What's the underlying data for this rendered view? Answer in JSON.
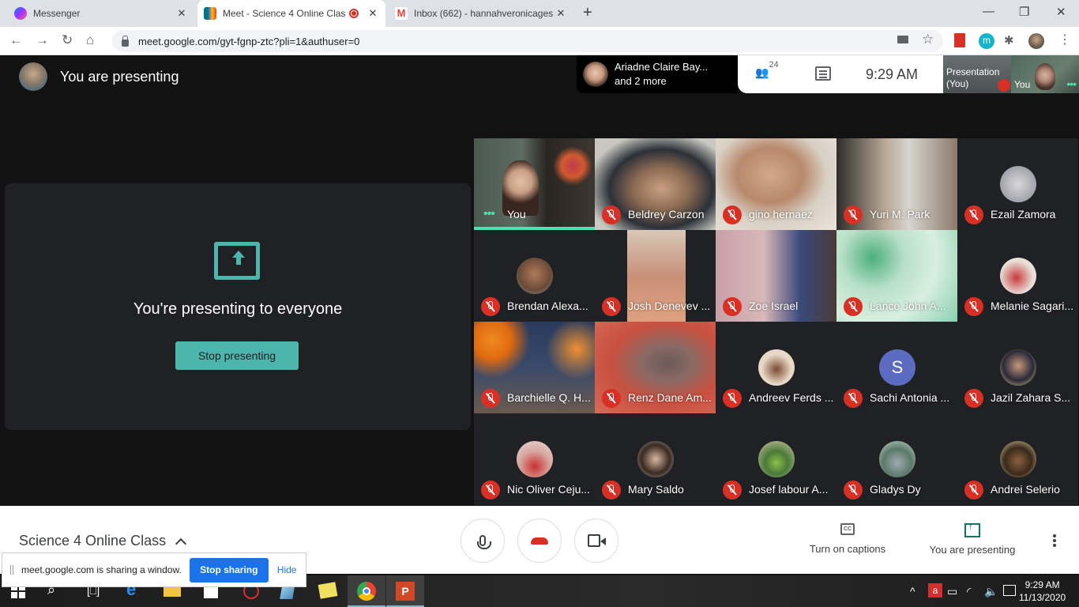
{
  "browser": {
    "tabs": [
      {
        "label": "Messenger",
        "icon": "messenger-icon",
        "active": false
      },
      {
        "label": "Meet - Science 4 Online Clas",
        "icon": "google-meet-icon",
        "active": true,
        "recording": true
      },
      {
        "label": "Inbox (662) - hannahveronicages",
        "icon": "gmail-icon",
        "active": false
      }
    ],
    "new_tab": "+",
    "window_controls": {
      "minimize": "—",
      "restore": "❐",
      "close": "✕"
    },
    "url": "meet.google.com/gyt-fgnp-ztc?pli=1&authuser=0",
    "nav": {
      "back": "←",
      "forward": "→",
      "reload": "↻",
      "home": "⌂"
    },
    "extensions": [
      "camera-icon",
      "star-icon",
      "red-book-extension-icon",
      "m-extension-icon",
      "puzzle-icon",
      "profile-avatar",
      "kebab-menu-icon"
    ],
    "m_ext_letter": "m"
  },
  "meet": {
    "header_title": "You are presenting",
    "presenter_info": {
      "line1": "Ariadne Claire Bay...",
      "line2": "and 2 more"
    },
    "people_count": "24",
    "clock": "9:29  AM",
    "mini_tiles": {
      "presentation": "Presentation\n(You)",
      "presentation_line1": "Presentation",
      "presentation_line2": "(You)",
      "self": "You"
    },
    "presenting_panel": {
      "message": "You're presenting to everyone",
      "button": "Stop presenting"
    },
    "participants": [
      {
        "name": "You",
        "muted": false,
        "speaking": true,
        "video": true
      },
      {
        "name": "Beldrey Carzon",
        "muted": true,
        "video": true
      },
      {
        "name": "gino hernaez",
        "muted": true,
        "video": true
      },
      {
        "name": "Yuri M. Park",
        "muted": true,
        "video": true
      },
      {
        "name": "Ezail Zamora",
        "muted": true,
        "video": false
      },
      {
        "name": "Brendan Alexa...",
        "muted": true,
        "video": false
      },
      {
        "name": "Josh Denevev ...",
        "muted": true,
        "video": true
      },
      {
        "name": "Zoe Israel",
        "muted": true,
        "video": true
      },
      {
        "name": "Lance John A...",
        "muted": true,
        "video": true
      },
      {
        "name": "Melanie Sagari...",
        "muted": true,
        "video": false
      },
      {
        "name": "Barchielle Q. H...",
        "muted": true,
        "video": true
      },
      {
        "name": "Renz Dane Am...",
        "muted": true,
        "video": true
      },
      {
        "name": "Andreev Ferds ...",
        "muted": true,
        "video": false
      },
      {
        "name": "Sachi Antonia ...",
        "muted": true,
        "video": false,
        "initial": "S"
      },
      {
        "name": "Jazil Zahara S...",
        "muted": true,
        "video": false
      },
      {
        "name": "Nic Oliver Ceju...",
        "muted": true,
        "video": false
      },
      {
        "name": "Mary Saldo",
        "muted": true,
        "video": false
      },
      {
        "name": "Josef labour A...",
        "muted": true,
        "video": false
      },
      {
        "name": "Gladys Dy",
        "muted": true,
        "video": false
      },
      {
        "name": "Andrei Selerio",
        "muted": true,
        "video": false
      }
    ],
    "bottom": {
      "meeting_title": "Science 4 Online Class",
      "captions_label": "Turn on captions",
      "captions_icon_text": "CC",
      "presenting_label": "You are presenting"
    }
  },
  "share_notice": {
    "text": "meet.google.com is sharing a window.",
    "stop_button": "Stop sharing",
    "hide_link": "Hide"
  },
  "taskbar": {
    "apps": [
      "windows-start-icon",
      "search-icon",
      "task-view-icon",
      "edge-icon",
      "file-explorer-icon",
      "store-icon",
      "app-icon",
      "app-icon-2",
      "sticky-notes-icon",
      "chrome-icon",
      "powerpoint-icon"
    ],
    "time": "9:29 AM",
    "date": "11/13/2020"
  },
  "colors": {
    "accent_teal": "#4db6ac",
    "mute_red": "#d93025",
    "share_blue": "#1a73e8",
    "speaking_green": "#4de0b0"
  }
}
